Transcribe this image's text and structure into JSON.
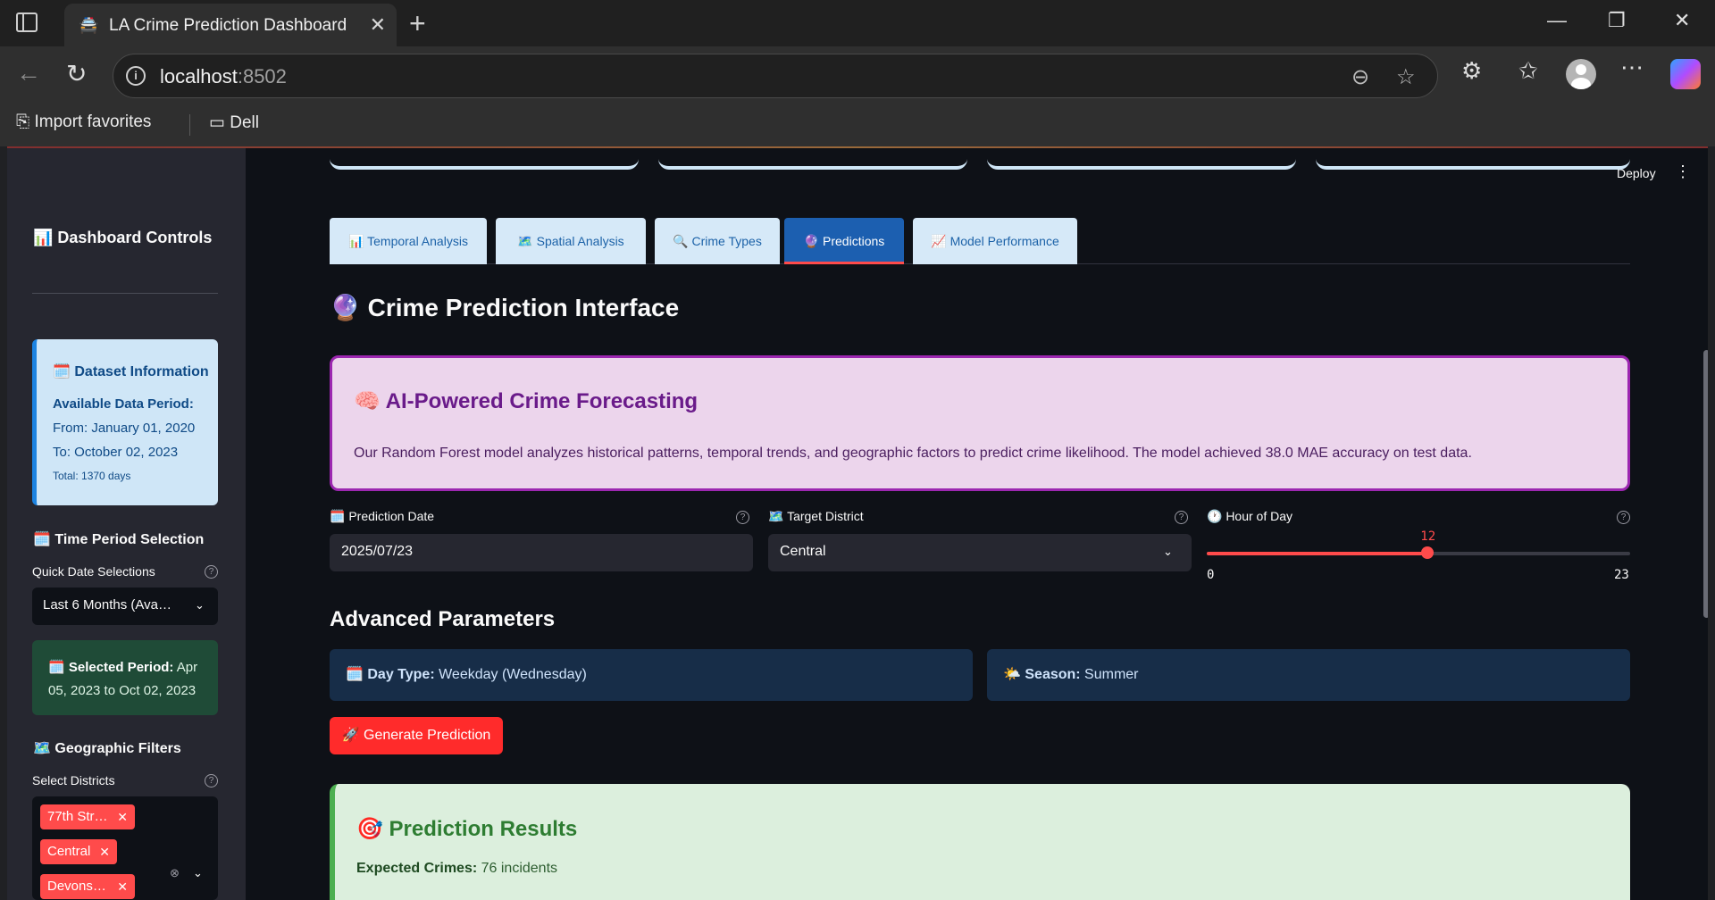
{
  "browser": {
    "tab_title": "LA Crime Prediction Dashboard",
    "tab_favicon": "🚔",
    "url_host": "localhost",
    "url_port": ":8502",
    "bookmarks": [
      "Import favorites",
      "Dell"
    ]
  },
  "app": {
    "deploy_label": "Deploy",
    "sidebar": {
      "title": "📊 Dashboard Controls",
      "dataset_info": {
        "heading": "🗓️ Dataset Information",
        "period_label": "Available Data Period:",
        "from": "From: January 01, 2020",
        "to": "To: October 02, 2023",
        "total": "Total: 1370 days"
      },
      "time_period_heading": "🗓️ Time Period Selection",
      "quick_date_label": "Quick Date Selections",
      "quick_date_value": "Last 6 Months (Ava…",
      "selected_period_bold": "🗓️ Selected Period:",
      "selected_period_text": " Apr 05, 2023 to Oct 02, 2023",
      "geo_heading": "🗺️ Geographic Filters",
      "districts_label": "Select Districts",
      "districts": [
        "77th Str…",
        "Central",
        "Devons…"
      ]
    },
    "tabs": [
      "📊 Temporal Analysis",
      "🗺️ Spatial Analysis",
      "🔍 Crime Types",
      "🔮 Predictions",
      "📈 Model Performance"
    ],
    "active_tab": "🔮 Predictions",
    "page_title": "🔮 Crime Prediction Interface",
    "forecast": {
      "heading": "🧠 AI-Powered Crime Forecasting",
      "text": "Our Random Forest model analyzes historical patterns, temporal trends, and geographic factors to predict crime likelihood. The model achieved 38.0 MAE accuracy on test data."
    },
    "inputs": {
      "date_label": "🗓️ Prediction Date",
      "date_value": "2025/07/23",
      "district_label": "🗺️ Target District",
      "district_value": "Central",
      "hour_label": "🕐 Hour of Day",
      "hour_value": 12,
      "hour_min": 0,
      "hour_max": 23
    },
    "advanced_heading": "Advanced Parameters",
    "day_type_label": "🗓️ Day Type:",
    "day_type_value": " Weekday (Wednesday)",
    "season_label": "🌤️ Season:",
    "season_value": " Summer",
    "generate_button": "🚀 Generate Prediction",
    "results": {
      "heading": "🎯 Prediction Results",
      "expected_label": "Expected Crimes:",
      "expected_value": " 76 incidents"
    }
  }
}
